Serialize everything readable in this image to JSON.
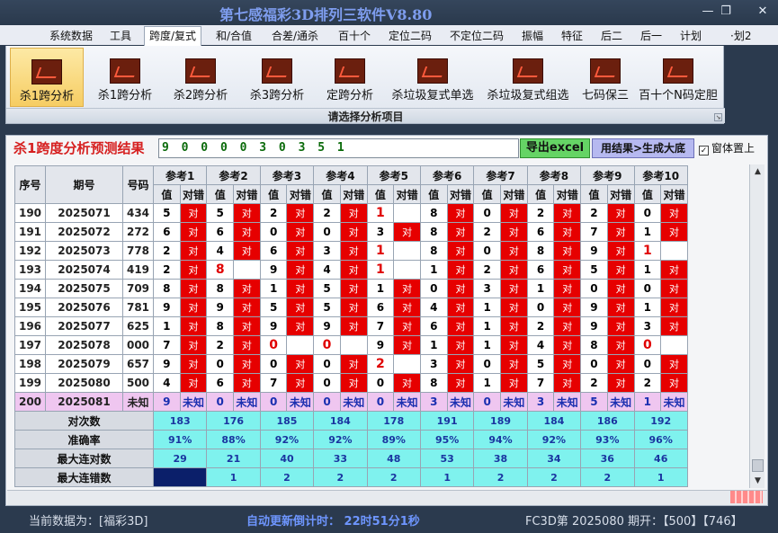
{
  "app_title": "第七感福彩3D排列三软件V8.80",
  "window_buttons": {
    "minimize": "—",
    "restore": "❐",
    "close": "✕"
  },
  "menu": [
    "系统数据",
    "工具",
    "跨度/复式",
    "和/合值",
    "合差/通杀",
    "百十个",
    "定位二码",
    "不定位二码",
    "振幅",
    "特征",
    "后二",
    "后一",
    "计划",
    "·划2"
  ],
  "ribbon": {
    "buttons": [
      "杀1跨分析",
      "杀1跨分析",
      "杀2跨分析",
      "杀3跨分析",
      "定跨分析",
      "杀垃圾复式单选",
      "杀垃圾复式组选",
      "七码保三",
      "百十个N码定胆"
    ],
    "caption": "请选择分析项目",
    "launcher": "↘"
  },
  "panel": {
    "result_label": "杀1跨度分析预测结果",
    "result_value": "9 0 0 0 0 3 0 3 5 1",
    "excel_button": "导出excel",
    "generate_button": "用结果>生成大底",
    "topmost_check": "✓",
    "topmost_label": "窗体置上"
  },
  "table": {
    "headers": {
      "index": "序号",
      "issue": "期号",
      "number": "号码"
    },
    "refs": [
      "参考1",
      "参考2",
      "参考3",
      "参考4",
      "参考5",
      "参考6",
      "参考7",
      "参考8",
      "参考9",
      "参考10"
    ],
    "sub": {
      "value": "值",
      "match": "对错"
    },
    "hit_mark": "对",
    "rows": [
      {
        "idx": "190",
        "issue": "2025071",
        "num": "434",
        "vals": [
          "5",
          "5",
          "2",
          "2",
          "1",
          "8",
          "0",
          "2",
          "2",
          "0"
        ],
        "hot": [
          false,
          false,
          false,
          false,
          true,
          false,
          false,
          false,
          false,
          false
        ],
        "hits": [
          true,
          true,
          true,
          true,
          false,
          true,
          true,
          true,
          true,
          true
        ]
      },
      {
        "idx": "191",
        "issue": "2025072",
        "num": "272",
        "vals": [
          "6",
          "6",
          "0",
          "0",
          "3",
          "8",
          "2",
          "6",
          "7",
          "1"
        ],
        "hot": [
          false,
          false,
          false,
          false,
          false,
          false,
          false,
          false,
          false,
          false
        ],
        "hits": [
          true,
          true,
          true,
          true,
          true,
          true,
          true,
          true,
          true,
          true
        ]
      },
      {
        "idx": "192",
        "issue": "2025073",
        "num": "778",
        "vals": [
          "2",
          "4",
          "6",
          "3",
          "1",
          "8",
          "0",
          "8",
          "9",
          "1"
        ],
        "hot": [
          false,
          false,
          false,
          false,
          true,
          false,
          false,
          false,
          false,
          true
        ],
        "hits": [
          true,
          true,
          true,
          true,
          false,
          true,
          true,
          true,
          true,
          false
        ]
      },
      {
        "idx": "193",
        "issue": "2025074",
        "num": "419",
        "vals": [
          "2",
          "8",
          "9",
          "4",
          "1",
          "1",
          "2",
          "6",
          "5",
          "1"
        ],
        "hot": [
          false,
          true,
          false,
          false,
          true,
          false,
          false,
          false,
          false,
          false
        ],
        "hits": [
          true,
          false,
          true,
          true,
          false,
          true,
          true,
          true,
          true,
          true
        ]
      },
      {
        "idx": "194",
        "issue": "2025075",
        "num": "709",
        "vals": [
          "8",
          "8",
          "1",
          "5",
          "1",
          "0",
          "3",
          "1",
          "0",
          "0"
        ],
        "hot": [
          false,
          false,
          false,
          false,
          false,
          false,
          false,
          false,
          false,
          false
        ],
        "hits": [
          true,
          true,
          true,
          true,
          true,
          true,
          true,
          true,
          true,
          true
        ]
      },
      {
        "idx": "195",
        "issue": "2025076",
        "num": "781",
        "vals": [
          "9",
          "9",
          "5",
          "5",
          "6",
          "4",
          "1",
          "0",
          "9",
          "1"
        ],
        "hot": [
          false,
          false,
          false,
          false,
          false,
          false,
          false,
          false,
          false,
          false
        ],
        "hits": [
          true,
          true,
          true,
          true,
          true,
          true,
          true,
          true,
          true,
          true
        ]
      },
      {
        "idx": "196",
        "issue": "2025077",
        "num": "625",
        "vals": [
          "1",
          "8",
          "9",
          "9",
          "7",
          "6",
          "1",
          "2",
          "9",
          "3"
        ],
        "hot": [
          false,
          false,
          false,
          false,
          false,
          false,
          false,
          false,
          false,
          false
        ],
        "hits": [
          true,
          true,
          true,
          true,
          true,
          true,
          true,
          true,
          true,
          true
        ]
      },
      {
        "idx": "197",
        "issue": "2025078",
        "num": "000",
        "vals": [
          "7",
          "2",
          "0",
          "0",
          "9",
          "1",
          "1",
          "4",
          "8",
          "0"
        ],
        "hot": [
          false,
          false,
          true,
          true,
          false,
          false,
          false,
          false,
          false,
          true
        ],
        "hits": [
          true,
          true,
          false,
          false,
          true,
          true,
          true,
          true,
          true,
          false
        ]
      },
      {
        "idx": "198",
        "issue": "2025079",
        "num": "657",
        "vals": [
          "9",
          "0",
          "0",
          "0",
          "2",
          "3",
          "0",
          "5",
          "0",
          "0"
        ],
        "hot": [
          false,
          false,
          false,
          false,
          true,
          false,
          false,
          false,
          false,
          false
        ],
        "hits": [
          true,
          true,
          true,
          true,
          false,
          true,
          true,
          true,
          true,
          true
        ]
      },
      {
        "idx": "199",
        "issue": "2025080",
        "num": "500",
        "vals": [
          "4",
          "6",
          "7",
          "0",
          "0",
          "8",
          "1",
          "7",
          "2",
          "2"
        ],
        "hot": [
          false,
          false,
          false,
          false,
          false,
          false,
          false,
          false,
          false,
          false
        ],
        "hits": [
          true,
          true,
          true,
          true,
          true,
          true,
          true,
          true,
          true,
          true
        ]
      }
    ],
    "pred_row": {
      "idx": "200",
      "issue": "2025081",
      "num": "未知",
      "vals": [
        "9",
        "0",
        "0",
        "0",
        "0",
        "3",
        "0",
        "3",
        "5",
        "1"
      ],
      "unknown": "未知"
    },
    "stats": [
      {
        "label": "对次数",
        "vals": [
          "183",
          "176",
          "185",
          "184",
          "178",
          "191",
          "189",
          "184",
          "186",
          "192"
        ]
      },
      {
        "label": "准确率",
        "vals": [
          "91%",
          "88%",
          "92%",
          "92%",
          "89%",
          "95%",
          "94%",
          "92%",
          "93%",
          "96%"
        ]
      },
      {
        "label": "最大连对数",
        "vals": [
          "29",
          "21",
          "40",
          "33",
          "48",
          "53",
          "38",
          "34",
          "36",
          "46"
        ]
      },
      {
        "label": "最大连错数",
        "vals": [
          "",
          "1",
          "2",
          "2",
          "2",
          "1",
          "2",
          "2",
          "2",
          "1"
        ]
      }
    ]
  },
  "scrollbar": {
    "up": "▲",
    "down": "▼"
  },
  "status": {
    "current_label": "当前数据为：[福彩3D]",
    "countdown": "自动更新倒计时：  22时51分1秒",
    "issue_info": "FC3D第 2025080 期开：【500】【746】"
  }
}
